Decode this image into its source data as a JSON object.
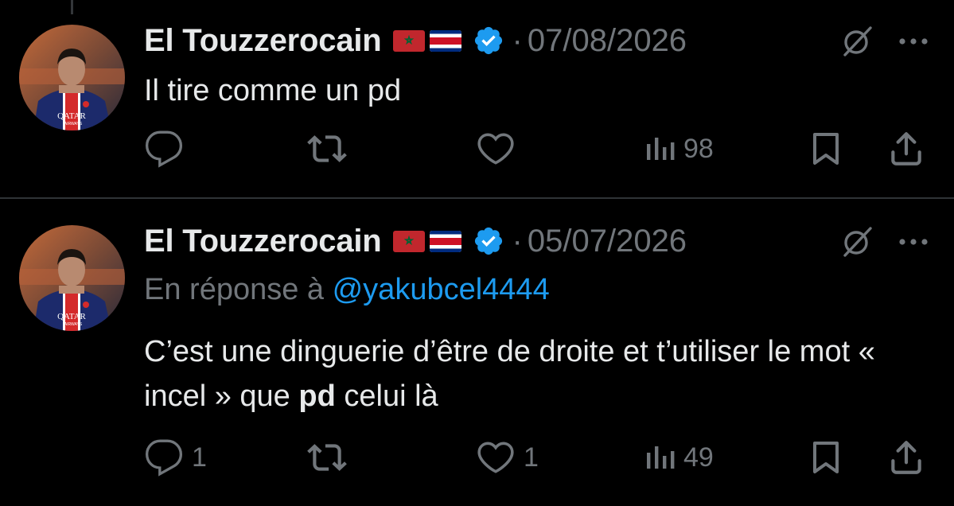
{
  "tweets": [
    {
      "author": {
        "display_name": "El Touzzerocain",
        "flags": [
          "morocco-flag",
          "costa-rica-flag"
        ],
        "verified": true,
        "avatar": "avatar-psg-player"
      },
      "separator": "·",
      "date": "07/08/2026",
      "reply_prefix": "",
      "reply_to": "",
      "text_segments": [
        "Il tire comme un pd"
      ],
      "actions": {
        "reply_count": "",
        "retweet_count": "",
        "like_count": "",
        "views_count": "98"
      }
    },
    {
      "author": {
        "display_name": "El Touzzerocain",
        "flags": [
          "morocco-flag",
          "costa-rica-flag"
        ],
        "verified": true,
        "avatar": "avatar-psg-player"
      },
      "separator": "·",
      "date": "05/07/2026",
      "reply_prefix": "En réponse à ",
      "reply_to": "@yakubcel4444",
      "text_segments": [
        "C’est une dinguerie d’être de droite et t’utiliser le mot « incel » que ",
        "pd",
        " celui là"
      ],
      "actions": {
        "reply_count": "1",
        "retweet_count": "",
        "like_count": "1",
        "views_count": "49"
      }
    }
  ],
  "colors": {
    "background": "#000000",
    "primary_text": "#e7e9ea",
    "secondary_text": "#71767b",
    "link": "#1d9bf0",
    "verified_badge": "#1d9bf0",
    "divider": "#2f3336"
  }
}
